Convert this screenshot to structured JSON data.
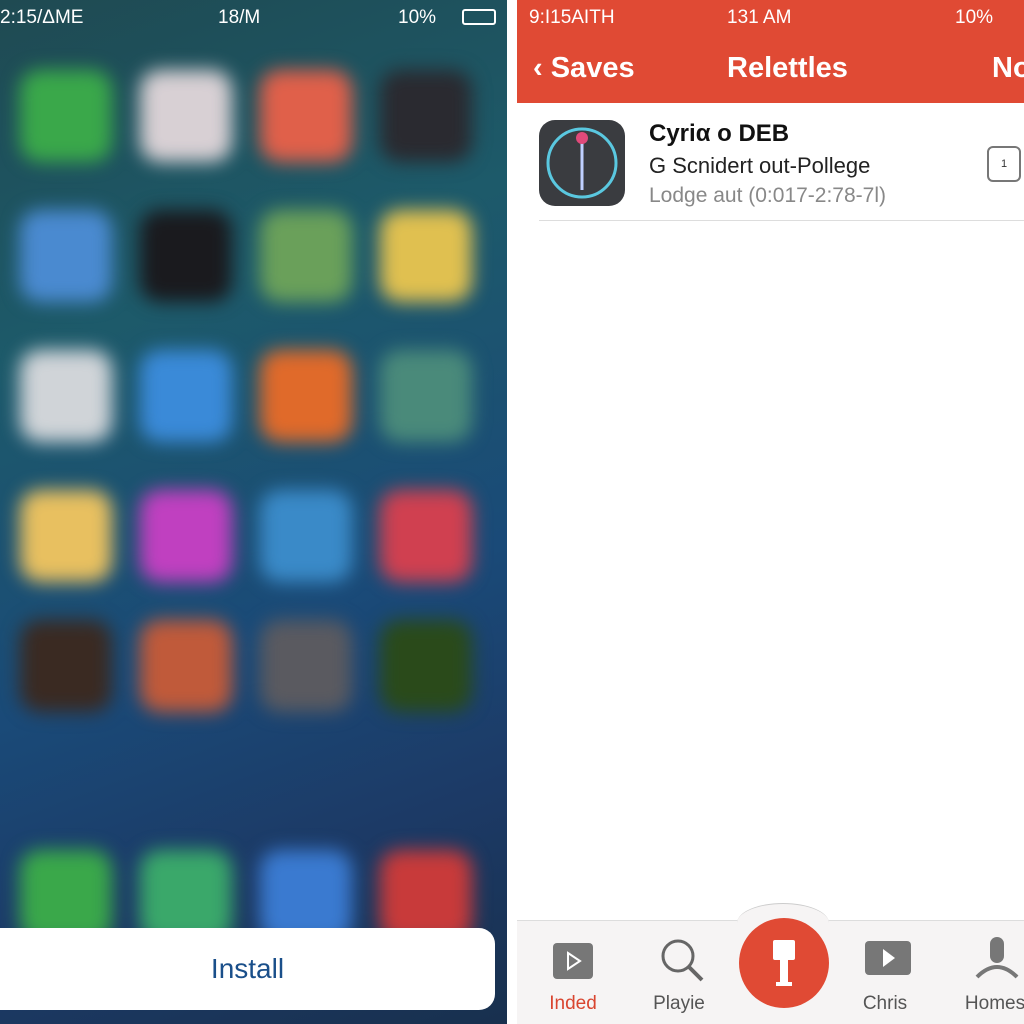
{
  "left": {
    "status": {
      "time": "2:15/ΔME",
      "center": "18/M",
      "battery": "10%"
    },
    "app_colors": [
      [
        "#3aa84a",
        "#d8d0d4",
        "#e0604a",
        "#2a2a30"
      ],
      [
        "#4a8ad0",
        "#1a1a1e",
        "#6aa05a",
        "#e0c050"
      ],
      [
        "#d0d4d8",
        "#3a8ad8",
        "#e06a2a",
        "#4a8a7a"
      ],
      [
        "#e8c060",
        "#c040c0",
        "#3a8ac8",
        "#d04050"
      ],
      [
        "#3a2a22",
        "#c05a3a",
        "#5a5a60",
        "#2a4a1a"
      ],
      [
        "#3aa84a",
        "#3aa86a",
        "#3a7ad0",
        "#c83a3a"
      ]
    ],
    "install_label": "Install"
  },
  "right": {
    "accent": "#e04a34",
    "status": {
      "time": "9:I15AITH",
      "center": "131 AM",
      "battery": "10%"
    },
    "nav": {
      "back": "Saves",
      "title": "Relettles",
      "right": "No"
    },
    "item": {
      "title": "Cyriα o DEB",
      "subtitle": "G Scnidert out-Pollege",
      "detail": "Lodge aut (0:017-2:78-7l)",
      "badge": "1"
    },
    "tabs": [
      {
        "label": "Inded",
        "icon": "package-icon",
        "active": true
      },
      {
        "label": "Playie",
        "icon": "search-icon"
      },
      {
        "label": "",
        "icon": "install-center-icon"
      },
      {
        "label": "Chris",
        "icon": "video-icon"
      },
      {
        "label": "Homes",
        "icon": "person-icon"
      }
    ]
  }
}
